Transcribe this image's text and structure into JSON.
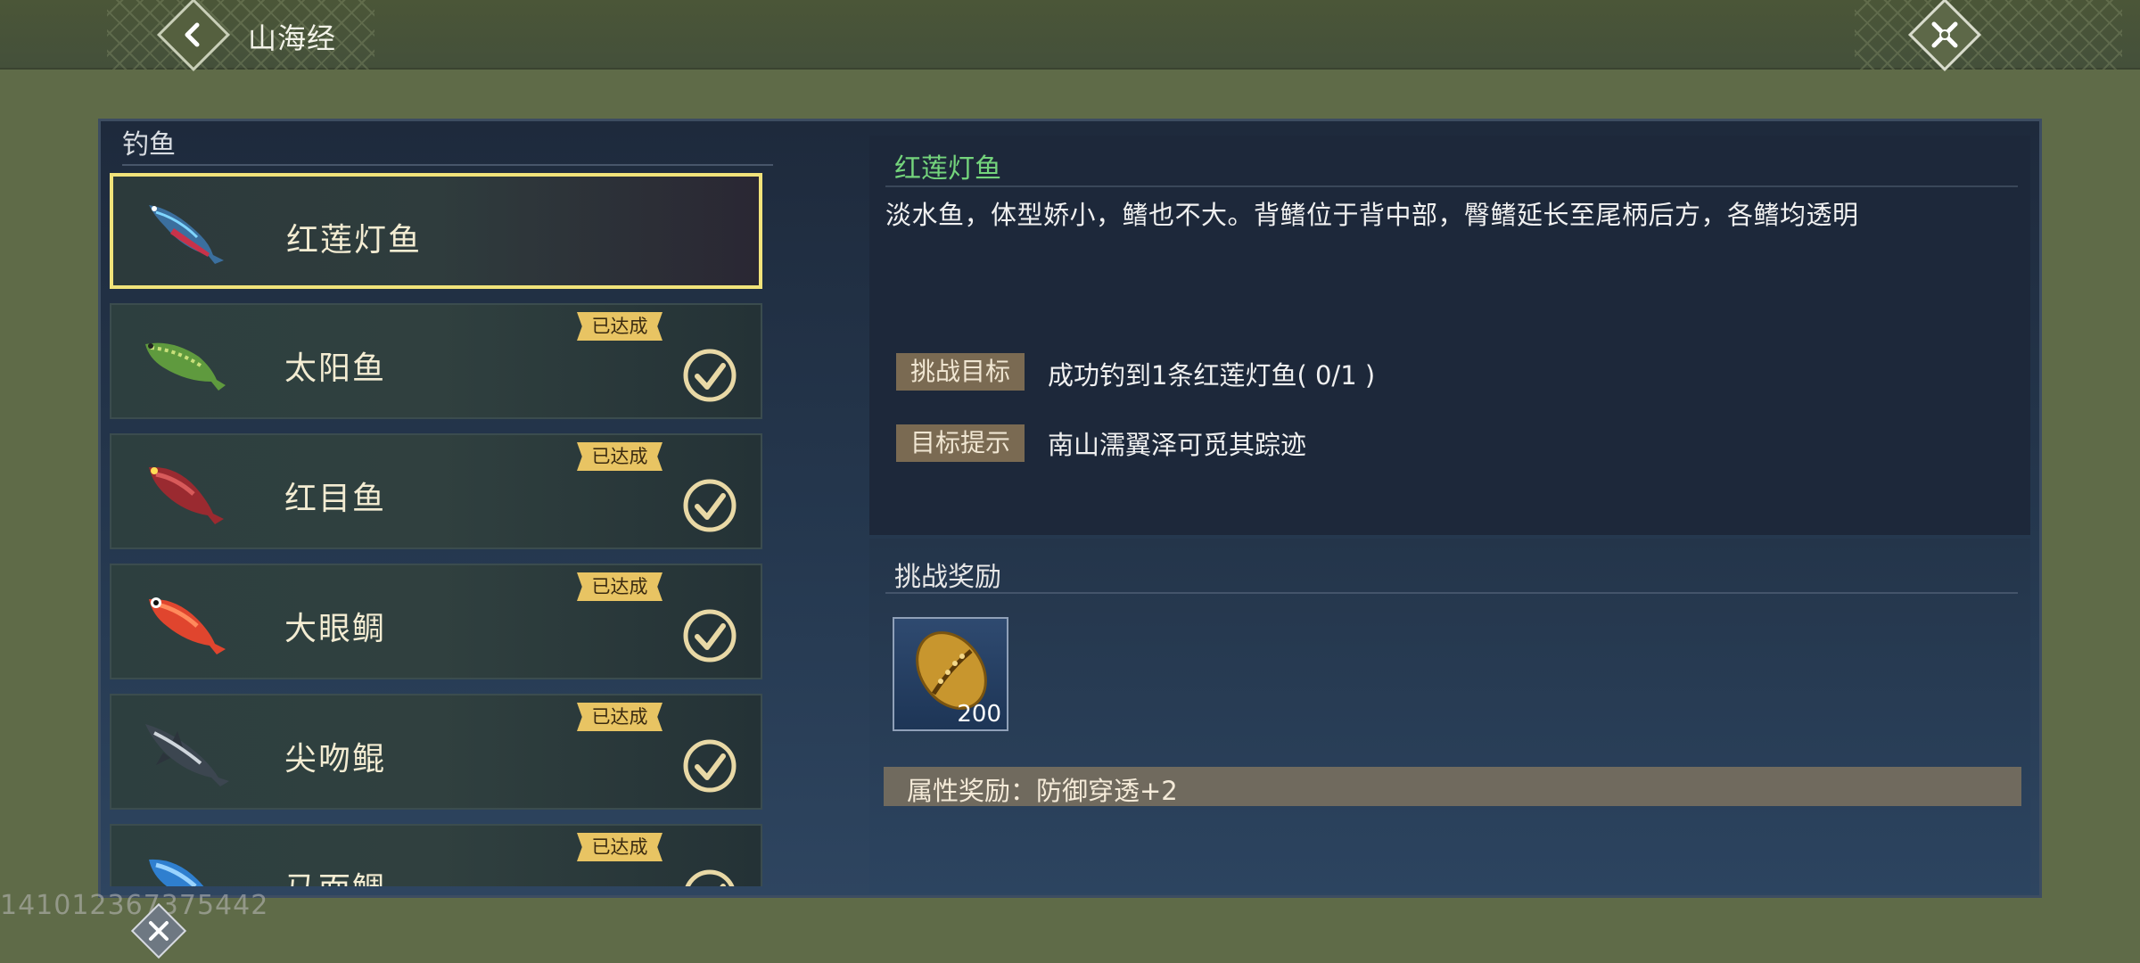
{
  "header": {
    "title": "山海经"
  },
  "list": {
    "header": "钓鱼",
    "items": [
      {
        "name": "红莲灯鱼",
        "selected": true,
        "achieved": false,
        "icon": "neon-fish-icon"
      },
      {
        "name": "太阳鱼",
        "selected": false,
        "achieved": true,
        "badge": "已达成",
        "icon": "sunfish-icon"
      },
      {
        "name": "红目鱼",
        "selected": false,
        "achieved": true,
        "badge": "已达成",
        "icon": "redeye-fish-icon"
      },
      {
        "name": "大眼鲷",
        "selected": false,
        "achieved": true,
        "badge": "已达成",
        "icon": "bigeye-fish-icon"
      },
      {
        "name": "尖吻鲲",
        "selected": false,
        "achieved": true,
        "badge": "已达成",
        "icon": "shark-icon"
      },
      {
        "name": "马面鲷",
        "selected": false,
        "achieved": true,
        "badge": "已达成",
        "icon": "blue-fish-icon"
      }
    ]
  },
  "detail": {
    "title": "红莲灯鱼",
    "description": "淡水鱼，体型娇小，鳍也不大。背鳍位于背中部，臀鳍延长至尾柄后方，各鳍均透明",
    "goal_label": "挑战目标",
    "goal_value": "成功钓到1条红莲灯鱼( 0/1 )",
    "hint_label": "目标提示",
    "hint_value": "南山濡翼泽可觅其踪迹"
  },
  "reward": {
    "title": "挑战奖励",
    "item_qty": "200",
    "item_icon": "cowrie-shell-icon",
    "attribute": "属性奖励：防御穿透+2"
  },
  "watermark": "141012367375442",
  "colors": {
    "accent_selected": "#f1e37a",
    "badge": "#e8c463",
    "title_green": "#74d47c",
    "background": "#5f6b48"
  }
}
